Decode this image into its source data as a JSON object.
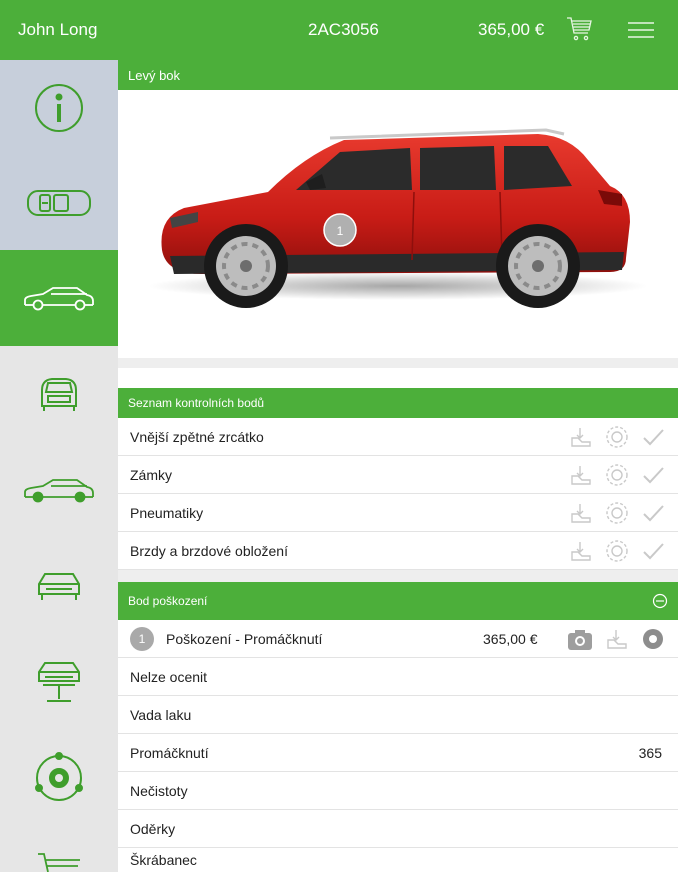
{
  "header": {
    "user": "John Long",
    "vehicle_id": "2AC3056",
    "total_price": "365,00 €",
    "cart_icon": "cart-icon",
    "menu_icon": "hamburger-menu-icon"
  },
  "sidebar": {
    "items": [
      {
        "icon": "info-icon",
        "active": false
      },
      {
        "icon": "car-top-view-icon",
        "active": false
      },
      {
        "icon": "car-side-view-icon",
        "active": true
      },
      {
        "icon": "car-rear-view-icon",
        "active": false
      },
      {
        "icon": "car-side-view-icon",
        "active": false
      },
      {
        "icon": "car-front-view-icon",
        "active": false
      },
      {
        "icon": "car-lift-icon",
        "active": false
      },
      {
        "icon": "wheel-check-icon",
        "active": false
      },
      {
        "icon": "cart-icon",
        "active": false
      }
    ]
  },
  "view": {
    "title": "Levý bok",
    "marker_label": "1",
    "car_color": "#d9211c"
  },
  "checklist": {
    "title": "Seznam kontrolních bodů",
    "items": [
      {
        "label": "Vnější zpětné zrcátko"
      },
      {
        "label": "Zámky"
      },
      {
        "label": "Pneumatiky"
      },
      {
        "label": "Brzdy a brzdové obložení"
      }
    ]
  },
  "damage": {
    "title": "Bod poškození",
    "point": {
      "number": "1",
      "label": "Poškození  - Promáčknutí",
      "price": "365,00 €"
    },
    "types": [
      {
        "label": "Nelze ocenit",
        "value": ""
      },
      {
        "label": "Vada laku",
        "value": ""
      },
      {
        "label": "Promáčknutí",
        "value": "365"
      },
      {
        "label": "Nečistoty",
        "value": ""
      },
      {
        "label": "Oděrky",
        "value": ""
      },
      {
        "label": "Škrábanec",
        "value": ""
      }
    ]
  },
  "colors": {
    "accent": "#4caf3a",
    "sidebar_bg": "#e6e6e6",
    "sidebar_highlight": "#c7cfdb",
    "icon_stroke": "#3f9e2c",
    "muted_icon": "#c9c9c9"
  }
}
